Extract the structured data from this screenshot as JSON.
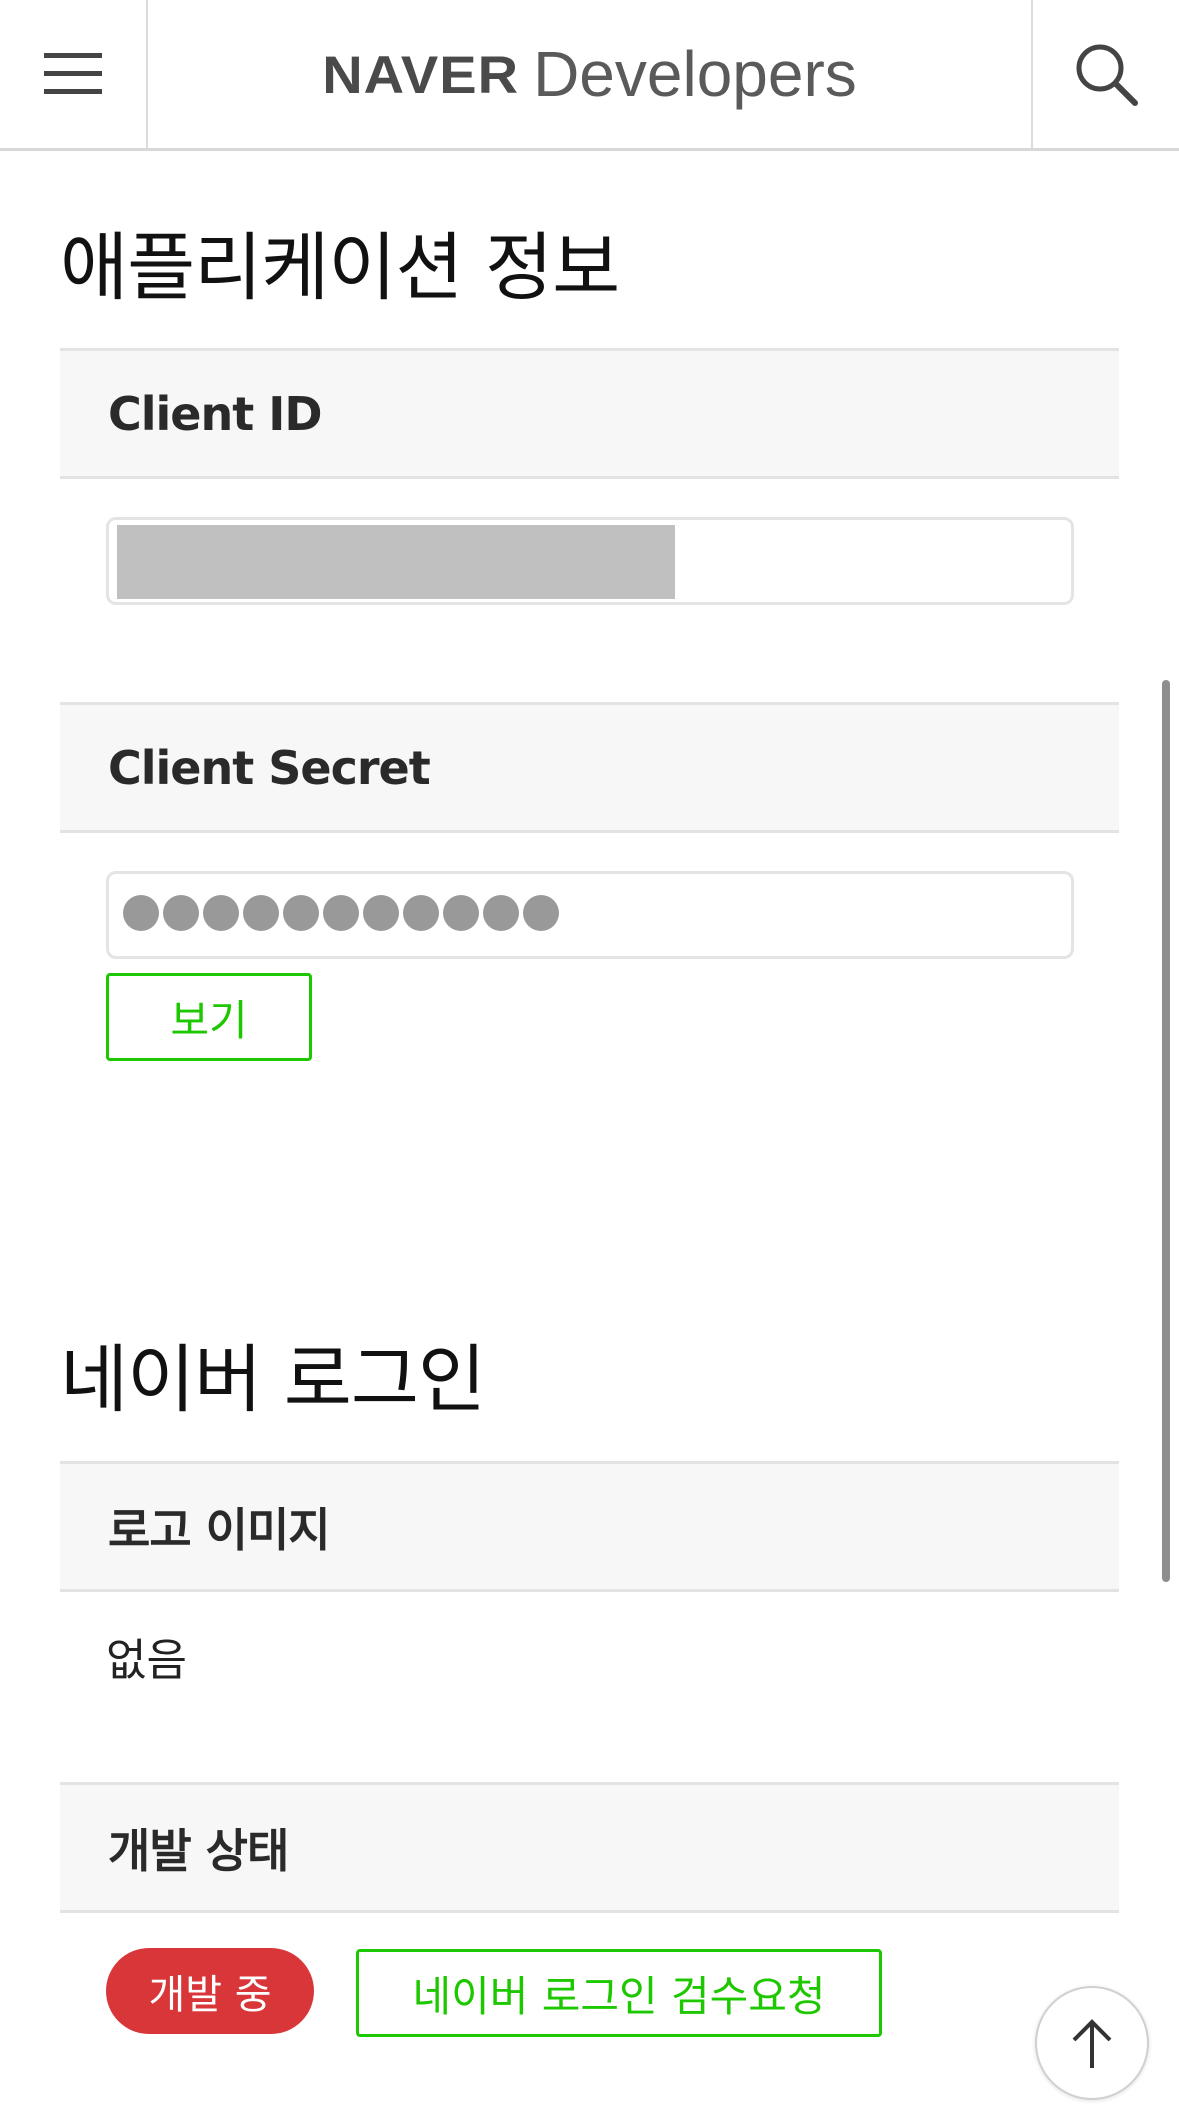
{
  "header": {
    "brand": "NAVER",
    "product": "Developers",
    "menu_icon": "hamburger-menu-icon",
    "search_icon": "search-icon"
  },
  "app_info": {
    "title": "애플리케이션 정보",
    "client_id_label": "Client ID",
    "client_secret_label": "Client Secret",
    "client_secret_mask_count": 11,
    "show_button": "보기"
  },
  "naver_login": {
    "title": "네이버 로그인",
    "logo_label": "로고 이미지",
    "logo_value": "없음",
    "status_label": "개발 상태",
    "status_badge": "개발 중",
    "review_button": "네이버 로그인 검수요청"
  },
  "colors": {
    "accent_green": "#1ec800",
    "status_red": "#d9363a"
  },
  "scroll_top_icon": "arrow-up-icon"
}
